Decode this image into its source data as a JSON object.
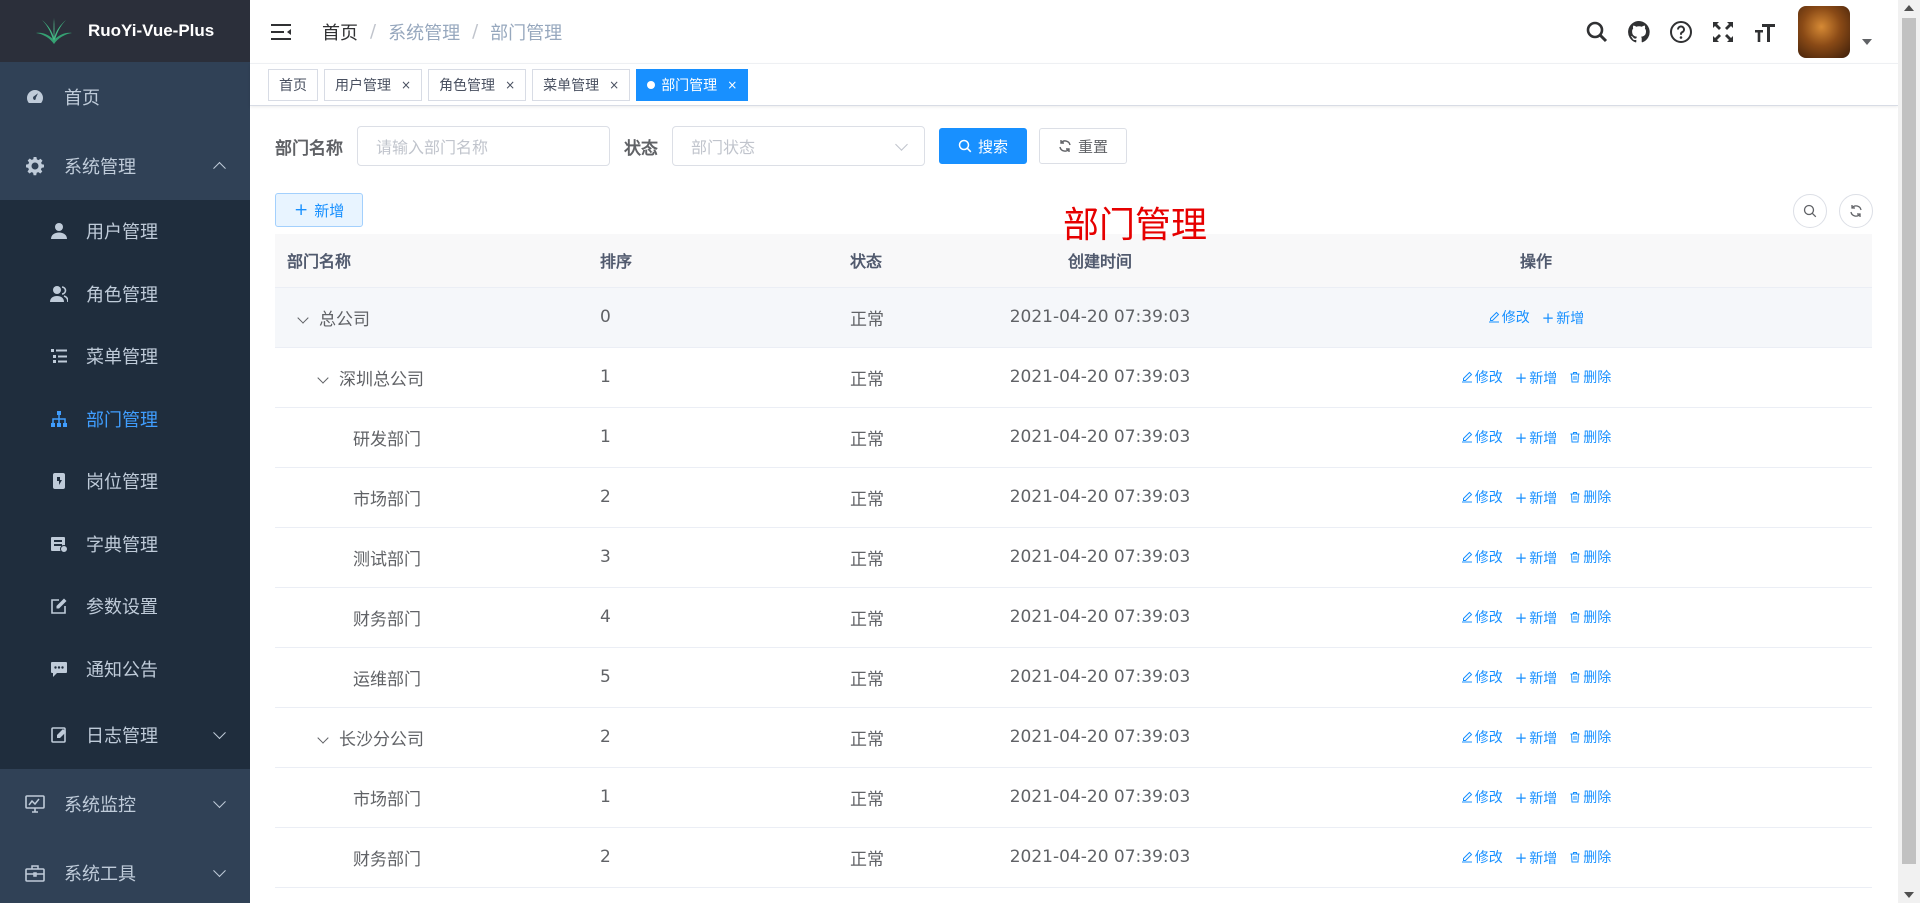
{
  "app": {
    "title": "RuoYi-Vue-Plus"
  },
  "sidebar": {
    "items": [
      {
        "label": "首页",
        "icon": "dashboard-icon"
      },
      {
        "label": "系统管理",
        "icon": "gear-icon",
        "expanded": true
      },
      {
        "label": "系统监控",
        "icon": "monitor-icon"
      },
      {
        "label": "系统工具",
        "icon": "toolbox-icon"
      }
    ],
    "sub": [
      {
        "label": "用户管理",
        "icon": "user-icon"
      },
      {
        "label": "角色管理",
        "icon": "users-icon"
      },
      {
        "label": "菜单管理",
        "icon": "tree-list-icon"
      },
      {
        "label": "部门管理",
        "icon": "org-tree-icon",
        "active": true
      },
      {
        "label": "岗位管理",
        "icon": "post-icon"
      },
      {
        "label": "字典管理",
        "icon": "dict-icon"
      },
      {
        "label": "参数设置",
        "icon": "edit-icon"
      },
      {
        "label": "通知公告",
        "icon": "message-icon"
      },
      {
        "label": "日志管理",
        "icon": "log-icon"
      }
    ]
  },
  "breadcrumb": {
    "home": "首页",
    "level1": "系统管理",
    "level2": "部门管理",
    "sep": "/"
  },
  "tags": [
    {
      "label": "首页"
    },
    {
      "label": "用户管理",
      "close": "×"
    },
    {
      "label": "角色管理",
      "close": "×"
    },
    {
      "label": "菜单管理",
      "close": "×"
    },
    {
      "label": "部门管理",
      "close": "×",
      "active": true
    }
  ],
  "search": {
    "name_label": "部门名称",
    "name_placeholder": "请输入部门名称",
    "status_label": "状态",
    "status_placeholder": "部门状态",
    "search_btn": "搜索",
    "reset_btn": "重置"
  },
  "toolbar": {
    "add_btn": "新增"
  },
  "watermark": "部门管理",
  "table": {
    "headers": {
      "name": "部门名称",
      "sort": "排序",
      "status": "状态",
      "time": "创建时间",
      "ops": "操作"
    },
    "ops": {
      "edit": "修改",
      "add": "新增",
      "delete": "删除"
    },
    "rows": [
      {
        "name": "总公司",
        "sort": "0",
        "status": "正常",
        "time": "2021-04-20 07:39:03"
      },
      {
        "name": "深圳总公司",
        "sort": "1",
        "status": "正常",
        "time": "2021-04-20 07:39:03"
      },
      {
        "name": "研发部门",
        "sort": "1",
        "status": "正常",
        "time": "2021-04-20 07:39:03"
      },
      {
        "name": "市场部门",
        "sort": "2",
        "status": "正常",
        "time": "2021-04-20 07:39:03"
      },
      {
        "name": "测试部门",
        "sort": "3",
        "status": "正常",
        "time": "2021-04-20 07:39:03"
      },
      {
        "name": "财务部门",
        "sort": "4",
        "status": "正常",
        "time": "2021-04-20 07:39:03"
      },
      {
        "name": "运维部门",
        "sort": "5",
        "status": "正常",
        "time": "2021-04-20 07:39:03"
      },
      {
        "name": "长沙分公司",
        "sort": "2",
        "status": "正常",
        "time": "2021-04-20 07:39:03"
      },
      {
        "name": "市场部门",
        "sort": "1",
        "status": "正常",
        "time": "2021-04-20 07:39:03"
      },
      {
        "name": "财务部门",
        "sort": "2",
        "status": "正常",
        "time": "2021-04-20 07:39:03"
      }
    ]
  },
  "colors": {
    "primary": "#1890ff",
    "sidebar": "#304156",
    "submenu": "#1f2d3d",
    "watermark": "#e60000"
  }
}
